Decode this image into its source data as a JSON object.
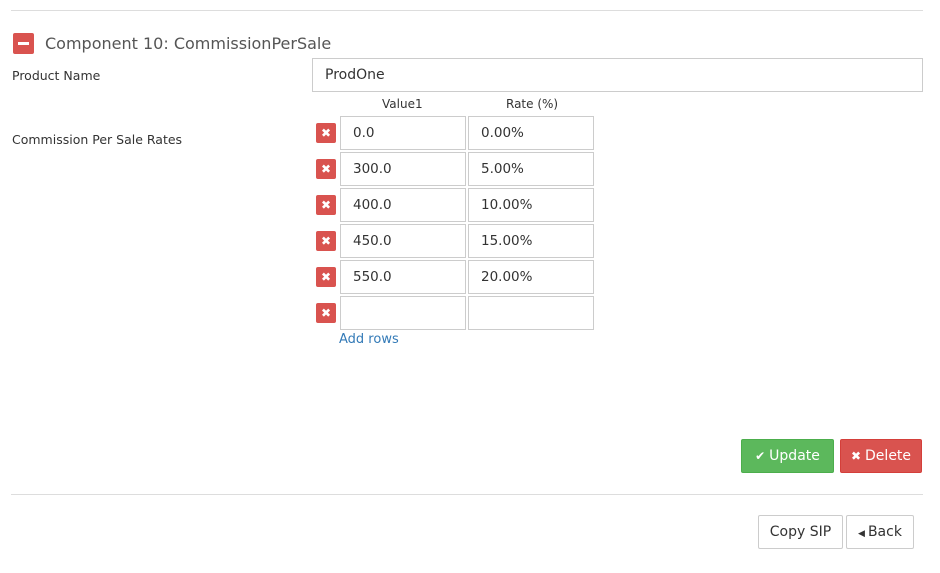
{
  "component": {
    "title": "Component 10: CommissionPerSale",
    "collapse_icon": "minus-icon"
  },
  "product": {
    "label": "Product Name",
    "value": "ProdOne"
  },
  "rates": {
    "label": "Commission Per Sale Rates",
    "headers": {
      "value": "Value1",
      "rate": "Rate (%)"
    },
    "delete_icon": "close-icon",
    "delete_glyph": "✖",
    "rows": [
      {
        "value": "0.0",
        "rate": "0.00%"
      },
      {
        "value": "300.0",
        "rate": "5.00%"
      },
      {
        "value": "400.0",
        "rate": "10.00%"
      },
      {
        "value": "450.0",
        "rate": "15.00%"
      },
      {
        "value": "550.0",
        "rate": "20.00%"
      },
      {
        "value": "",
        "rate": ""
      }
    ],
    "add_rows_label": "Add rows"
  },
  "actions": {
    "update_label": "Update",
    "update_glyph": "✔",
    "delete_label": "Delete",
    "delete_glyph": "✖",
    "copy_label": "Copy SIP",
    "back_label": "Back",
    "back_glyph": "◀"
  },
  "colors": {
    "danger": "#d9534f",
    "success": "#5cb85c",
    "link": "#337ab7"
  }
}
